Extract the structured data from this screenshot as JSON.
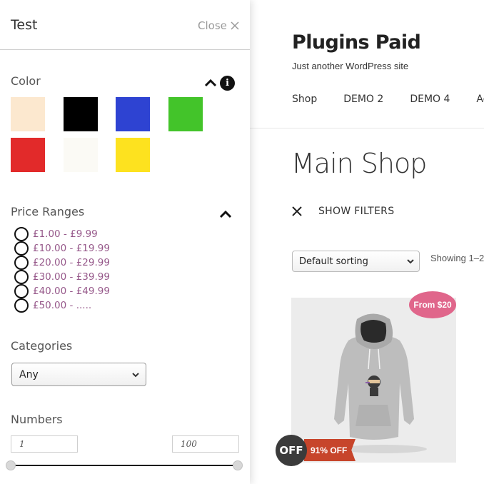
{
  "site": {
    "title": "Plugins Paid",
    "tagline": "Just another WordPress site",
    "nav": [
      "Shop",
      "DEMO 2",
      "DEMO 4",
      "Adic"
    ],
    "page_title": "Main Shop",
    "filters_label": "SHOW FILTERS",
    "sorting": {
      "selected": "Default sorting"
    },
    "result_count": "Showing 1–2",
    "product": {
      "price_badge": "From $20",
      "off_label": "OFF",
      "discount_label": "91% OFF",
      "badge_color": "#e0668b",
      "ribbon_color": "#c7452b"
    }
  },
  "panel": {
    "title": "Test",
    "close_label": "Close",
    "color": {
      "label": "Color",
      "swatches": [
        "#fce8cf",
        "#000000",
        "#2e43d2",
        "#43c42a",
        "#e22a2a",
        "#fbfaf5",
        "#fde21f"
      ]
    },
    "price": {
      "label": "Price Ranges",
      "ranges": [
        "£1.00 - £9.99",
        "£10.00 - £19.99",
        "£20.00 - £29.99",
        "£30.00 - £39.99",
        "£40.00 - £49.99",
        "£50.00 - ....."
      ],
      "link_color": "#96588a"
    },
    "categories": {
      "label": "Categories",
      "selected": "Any"
    },
    "numbers": {
      "label": "Numbers",
      "min": "1",
      "max": "100"
    }
  }
}
